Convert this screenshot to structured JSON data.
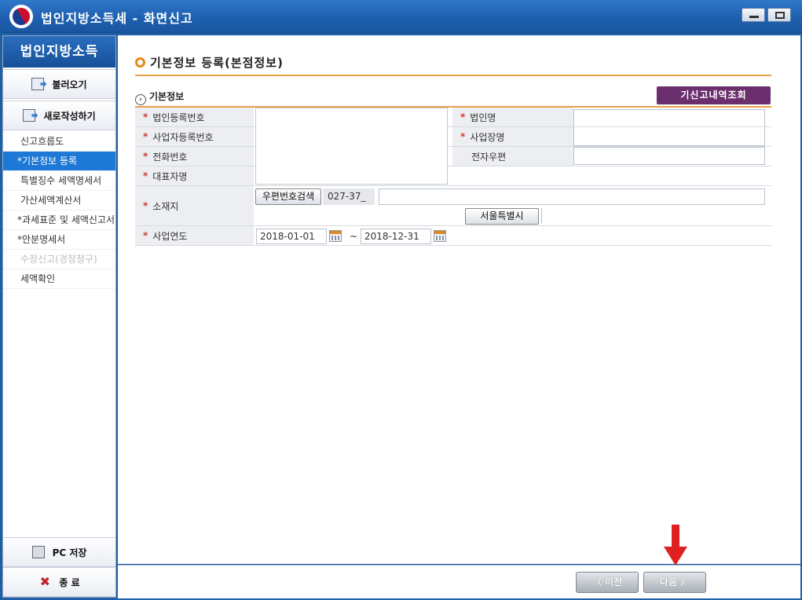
{
  "window": {
    "title": "법인지방소득세 - 화면신고"
  },
  "sidebar": {
    "header": "법인지방소득",
    "load_button": "불러오기",
    "new_button": "새로작성하기",
    "items": [
      {
        "label": "신고흐름도"
      },
      {
        "label": "*기본정보 등록"
      },
      {
        "label": "특별징수 세액명세서"
      },
      {
        "label": "가산세액계산서"
      },
      {
        "label": "*과세표준 및 세액신고서"
      },
      {
        "label": "*안분명세서"
      },
      {
        "label": "수정신고(경정청구)"
      },
      {
        "label": "세액확인"
      }
    ],
    "save_button": "PC 저장",
    "exit_button": "종 료"
  },
  "main": {
    "page_title": "기본정보 등록(본점정보)",
    "section_title": "기본정보",
    "history_button": "기신고내역조회",
    "form": {
      "corp_reg_no_label": "법인등록번호",
      "biz_reg_no_label": "사업자등록번호",
      "phone_label": "전화번호",
      "ceo_label": "대표자명",
      "corp_name_label": "법인명",
      "biz_name_label": "사업장명",
      "email_label": "전자우편",
      "address_label": "소재지",
      "zip_search_button": "우편번호검색",
      "zip_code": "027-37_",
      "address_detail": "",
      "city": "서울특별시",
      "period_label": "사업연도",
      "period_start": "2018-01-01",
      "period_sep": "~",
      "period_end": "2018-12-31"
    }
  },
  "footer": {
    "prev_button": "〈 이전",
    "next_button": "다음 〉"
  },
  "colors": {
    "accent_orange": "#e8a04a",
    "history_button": "#6b2f6e",
    "active_menu": "#1d78d6",
    "required_star": "#d13a2b",
    "annotation_arrow": "#e02020"
  }
}
